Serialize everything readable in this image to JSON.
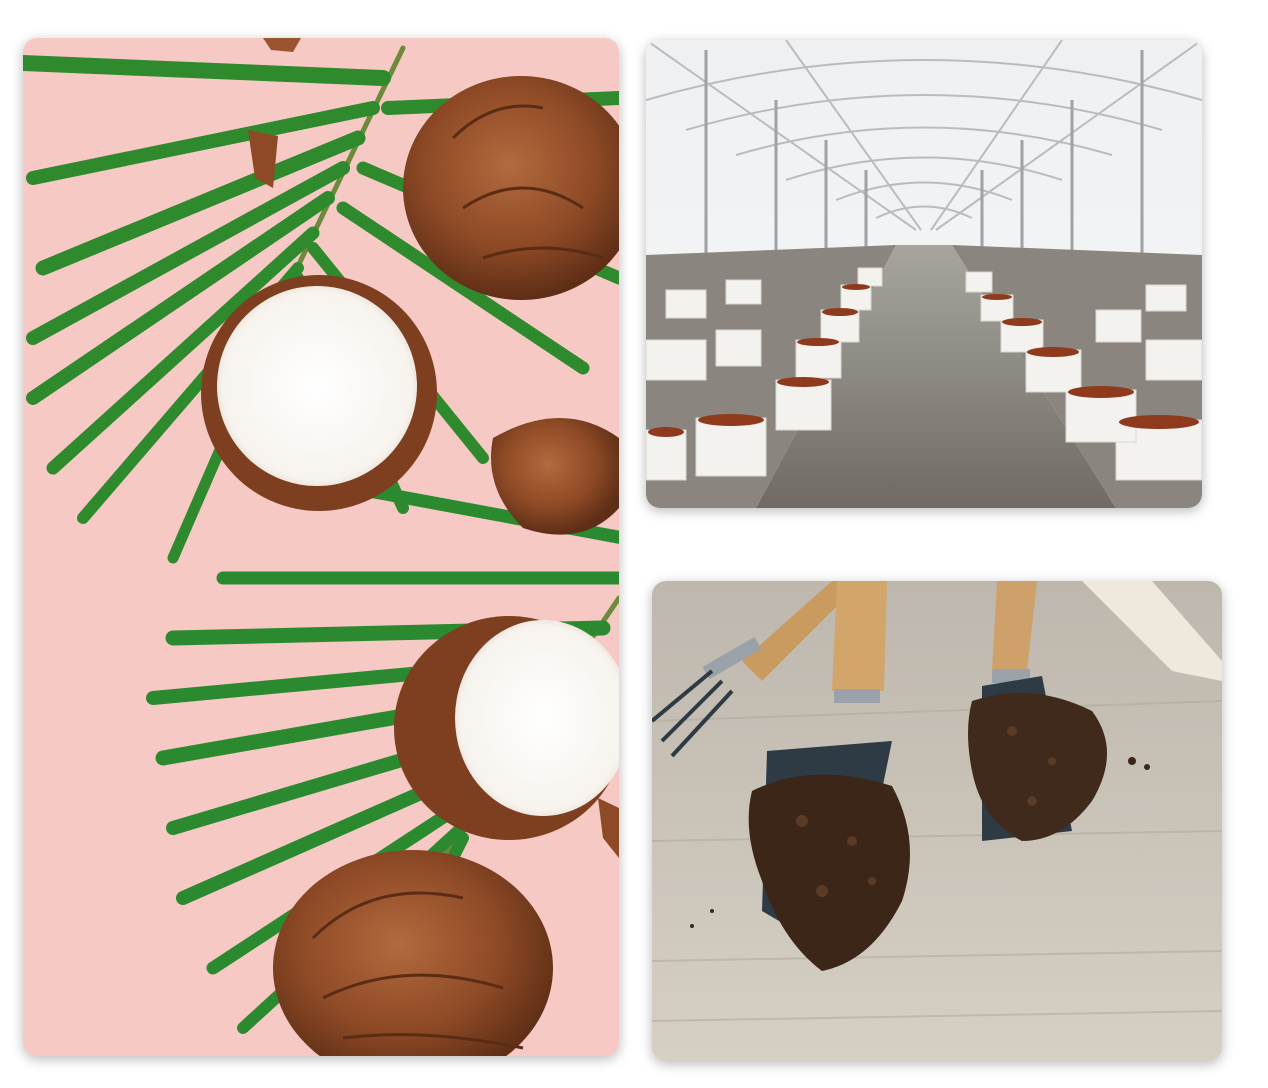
{
  "images": [
    {
      "name": "coconut-palm-photo",
      "colors": {
        "background": "#f6c9c4",
        "leaf": "#2f8a2e",
        "husk": "#8e4a26",
        "flesh": "#ffffff"
      }
    },
    {
      "name": "greenhouse-coir-bags-photo",
      "colors": {
        "frame": "#b9bcbf",
        "floor": "#7d7a74",
        "bag": "#f3f2ee",
        "coir": "#8f3a1d"
      }
    },
    {
      "name": "garden-tools-coir-photo",
      "colors": {
        "table": "#cfc8bd",
        "handle": "#d2a56a",
        "blade": "#2e3a44",
        "coir": "#3b2618"
      }
    }
  ]
}
